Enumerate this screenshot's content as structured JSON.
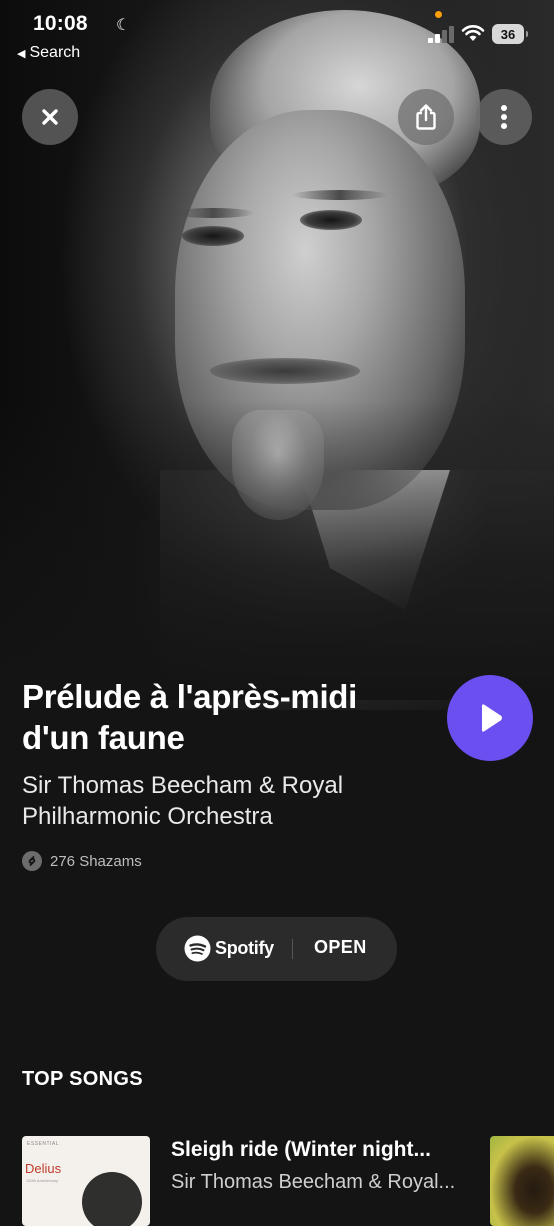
{
  "status_bar": {
    "time": "10:08",
    "back_label": "Search",
    "battery": "36"
  },
  "hero": {
    "image": "black-and-white portrait photo of the artist"
  },
  "song": {
    "title": "Prélude à l'après-midi d'un faune",
    "artist": "Sir Thomas Beecham & Royal Philharmonic Orchestra",
    "shazam_count": "276 Shazams"
  },
  "spotify": {
    "brand": "Spotify",
    "open_label": "OPEN"
  },
  "top_songs": {
    "heading": "TOP SONGS",
    "items": [
      {
        "title": "Sleigh ride (Winter night...",
        "artist": "Sir Thomas Beecham & Royal...",
        "album_label": "Delius",
        "album_tag": "ESSENTIAL",
        "album_subline": "150th Anniversary"
      }
    ]
  },
  "colors": {
    "background": "#141414",
    "play_button": "#6b4ff0",
    "pill": "#2b2b2b"
  },
  "icons": [
    "moon-icon",
    "signal-icon",
    "wifi-icon",
    "close-icon",
    "share-icon",
    "more-icon",
    "play-icon",
    "shazam-icon",
    "spotify-icon"
  ]
}
